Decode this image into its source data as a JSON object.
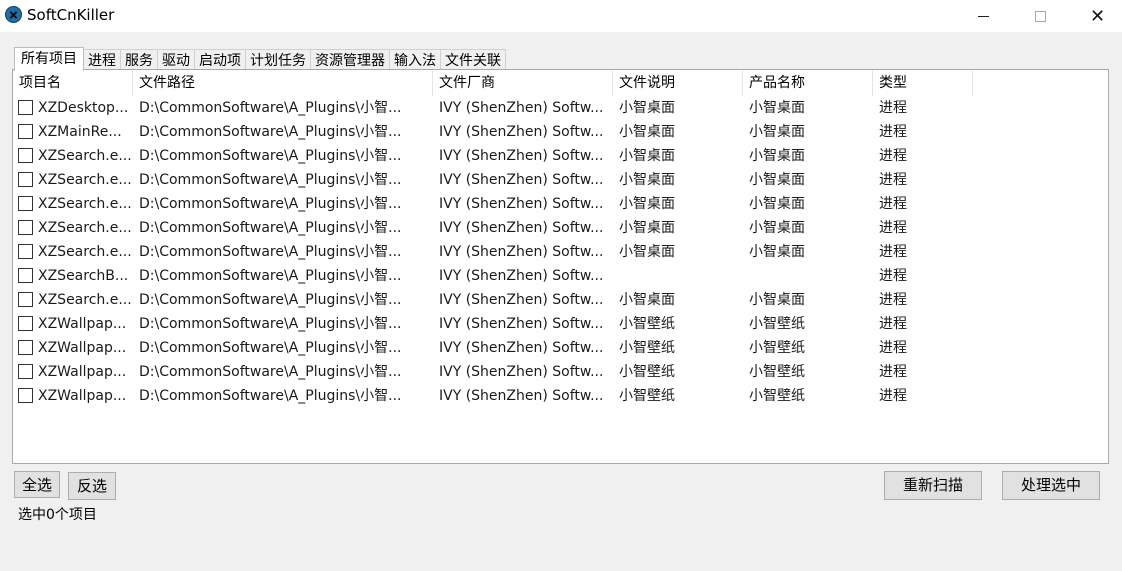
{
  "window": {
    "title": "SoftCnKiller",
    "minimize_symbol": "",
    "close_symbol": "✕"
  },
  "tabs": [
    "所有项目",
    "进程",
    "服务",
    "驱动",
    "启动项",
    "计划任务",
    "资源管理器",
    "输入法",
    "文件关联"
  ],
  "table": {
    "columns": [
      "项目名",
      "文件路径",
      "文件厂商",
      "文件说明",
      "产品名称",
      "类型"
    ],
    "rows": [
      [
        "XZDesktop...",
        "D:\\CommonSoftware\\A_Plugins\\小智...",
        "IVY (ShenZhen) Softw...",
        "小智桌面",
        "小智桌面",
        "进程"
      ],
      [
        "XZMainRe...",
        "D:\\CommonSoftware\\A_Plugins\\小智...",
        "IVY (ShenZhen) Softw...",
        "小智桌面",
        "小智桌面",
        "进程"
      ],
      [
        "XZSearch.e...",
        "D:\\CommonSoftware\\A_Plugins\\小智...",
        "IVY (ShenZhen) Softw...",
        "小智桌面",
        "小智桌面",
        "进程"
      ],
      [
        "XZSearch.e...",
        "D:\\CommonSoftware\\A_Plugins\\小智...",
        "IVY (ShenZhen) Softw...",
        "小智桌面",
        "小智桌面",
        "进程"
      ],
      [
        "XZSearch.e...",
        "D:\\CommonSoftware\\A_Plugins\\小智...",
        "IVY (ShenZhen) Softw...",
        "小智桌面",
        "小智桌面",
        "进程"
      ],
      [
        "XZSearch.e...",
        "D:\\CommonSoftware\\A_Plugins\\小智...",
        "IVY (ShenZhen) Softw...",
        "小智桌面",
        "小智桌面",
        "进程"
      ],
      [
        "XZSearch.e...",
        "D:\\CommonSoftware\\A_Plugins\\小智...",
        "IVY (ShenZhen) Softw...",
        "小智桌面",
        "小智桌面",
        "进程"
      ],
      [
        "XZSearchB...",
        "D:\\CommonSoftware\\A_Plugins\\小智...",
        "IVY (ShenZhen) Softw...",
        "",
        "",
        "进程"
      ],
      [
        "XZSearch.e...",
        "D:\\CommonSoftware\\A_Plugins\\小智...",
        "IVY (ShenZhen) Softw...",
        "小智桌面",
        "小智桌面",
        "进程"
      ],
      [
        "XZWallpap...",
        "D:\\CommonSoftware\\A_Plugins\\小智...",
        "IVY (ShenZhen) Softw...",
        "小智壁纸",
        "小智壁纸",
        "进程"
      ],
      [
        "XZWallpap...",
        "D:\\CommonSoftware\\A_Plugins\\小智...",
        "IVY (ShenZhen) Softw...",
        "小智壁纸",
        "小智壁纸",
        "进程"
      ],
      [
        "XZWallpap...",
        "D:\\CommonSoftware\\A_Plugins\\小智...",
        "IVY (ShenZhen) Softw...",
        "小智壁纸",
        "小智壁纸",
        "进程"
      ],
      [
        "XZWallpap...",
        "D:\\CommonSoftware\\A_Plugins\\小智...",
        "IVY (ShenZhen) Softw...",
        "小智壁纸",
        "小智壁纸",
        "进程"
      ]
    ]
  },
  "buttons": {
    "select_all": "全选",
    "invert": "反选",
    "rescan": "重新扫描",
    "process_selected": "处理选中"
  },
  "status": "选中0个项目"
}
